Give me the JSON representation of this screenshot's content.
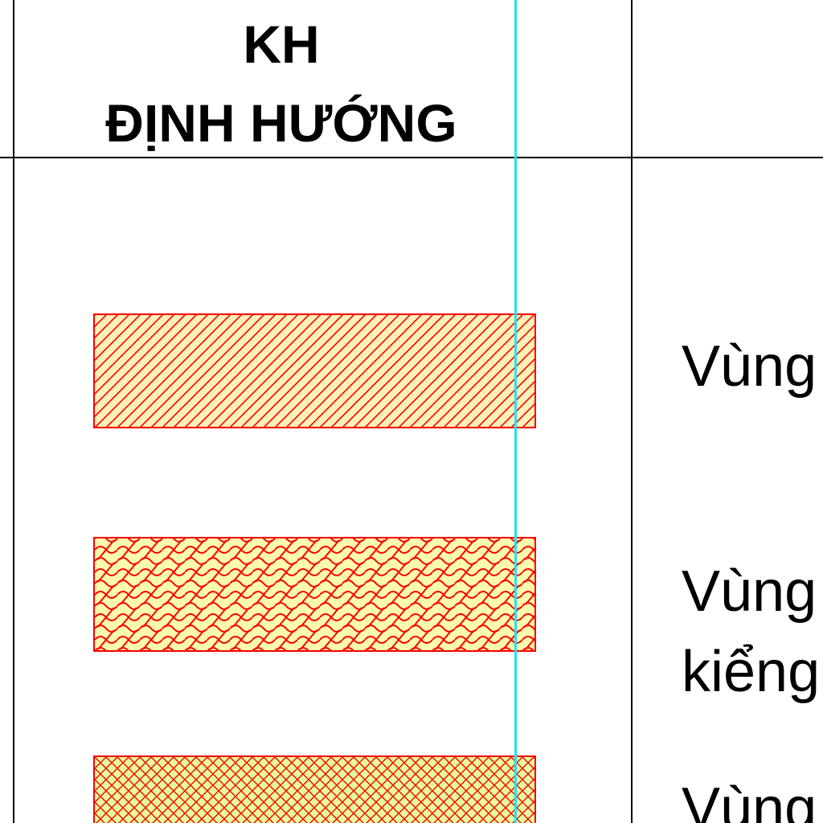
{
  "table": {
    "header": {
      "line1": "KH",
      "line2": "ĐỊNH HƯỚNG"
    },
    "rows": [
      {
        "pattern": "diagonal-hatch",
        "fill_color": "#fdf0b8",
        "stroke_color": "#ff0000",
        "label_lines": [
          "Vùng"
        ]
      },
      {
        "pattern": "scale-hatch",
        "fill_color": "#fdfcae",
        "stroke_color": "#ff0000",
        "label_lines": [
          "Vùng",
          "kiểng"
        ]
      },
      {
        "pattern": "cross-hatch",
        "fill_color": "#e4fb9e",
        "stroke_color": "#ff0000",
        "label_lines": [
          "Vùng"
        ]
      }
    ]
  },
  "colors": {
    "grid_line": "#000000",
    "guide_line": "#22e4ee",
    "hatch_border": "#ff0000"
  }
}
